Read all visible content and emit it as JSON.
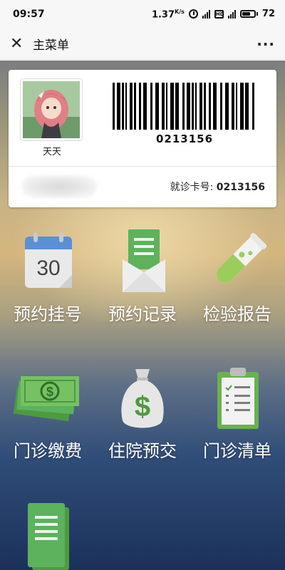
{
  "status_bar": {
    "time": "09:57",
    "net_speed": "1.37",
    "net_speed_unit": "K/s",
    "battery": "72"
  },
  "title_bar": {
    "title": "主菜单",
    "close_icon": "close-icon",
    "more_icon": "more-icon"
  },
  "card": {
    "avatar_name": "天天",
    "barcode_number": "0213156",
    "card_label": "就诊卡号:",
    "card_number": "0213156"
  },
  "menu": [
    {
      "id": "appointment-register",
      "label": "预约挂号",
      "icon": "calendar-icon",
      "calendar_day": "30"
    },
    {
      "id": "appointment-records",
      "label": "预约记录",
      "icon": "envelope-icon"
    },
    {
      "id": "lab-reports",
      "label": "检验报告",
      "icon": "test-tube-icon"
    },
    {
      "id": "outpatient-payment",
      "label": "门诊缴费",
      "icon": "cash-icon"
    },
    {
      "id": "inpatient-deposit",
      "label": "住院预交",
      "icon": "money-bag-icon"
    },
    {
      "id": "outpatient-list",
      "label": "门诊清单",
      "icon": "clipboard-icon"
    },
    {
      "id": "documents",
      "label": "",
      "icon": "document-icon"
    }
  ],
  "colors": {
    "green": "#5cb25d",
    "green_dark": "#3f8f45",
    "calendar_blue": "#5b8fd6"
  }
}
